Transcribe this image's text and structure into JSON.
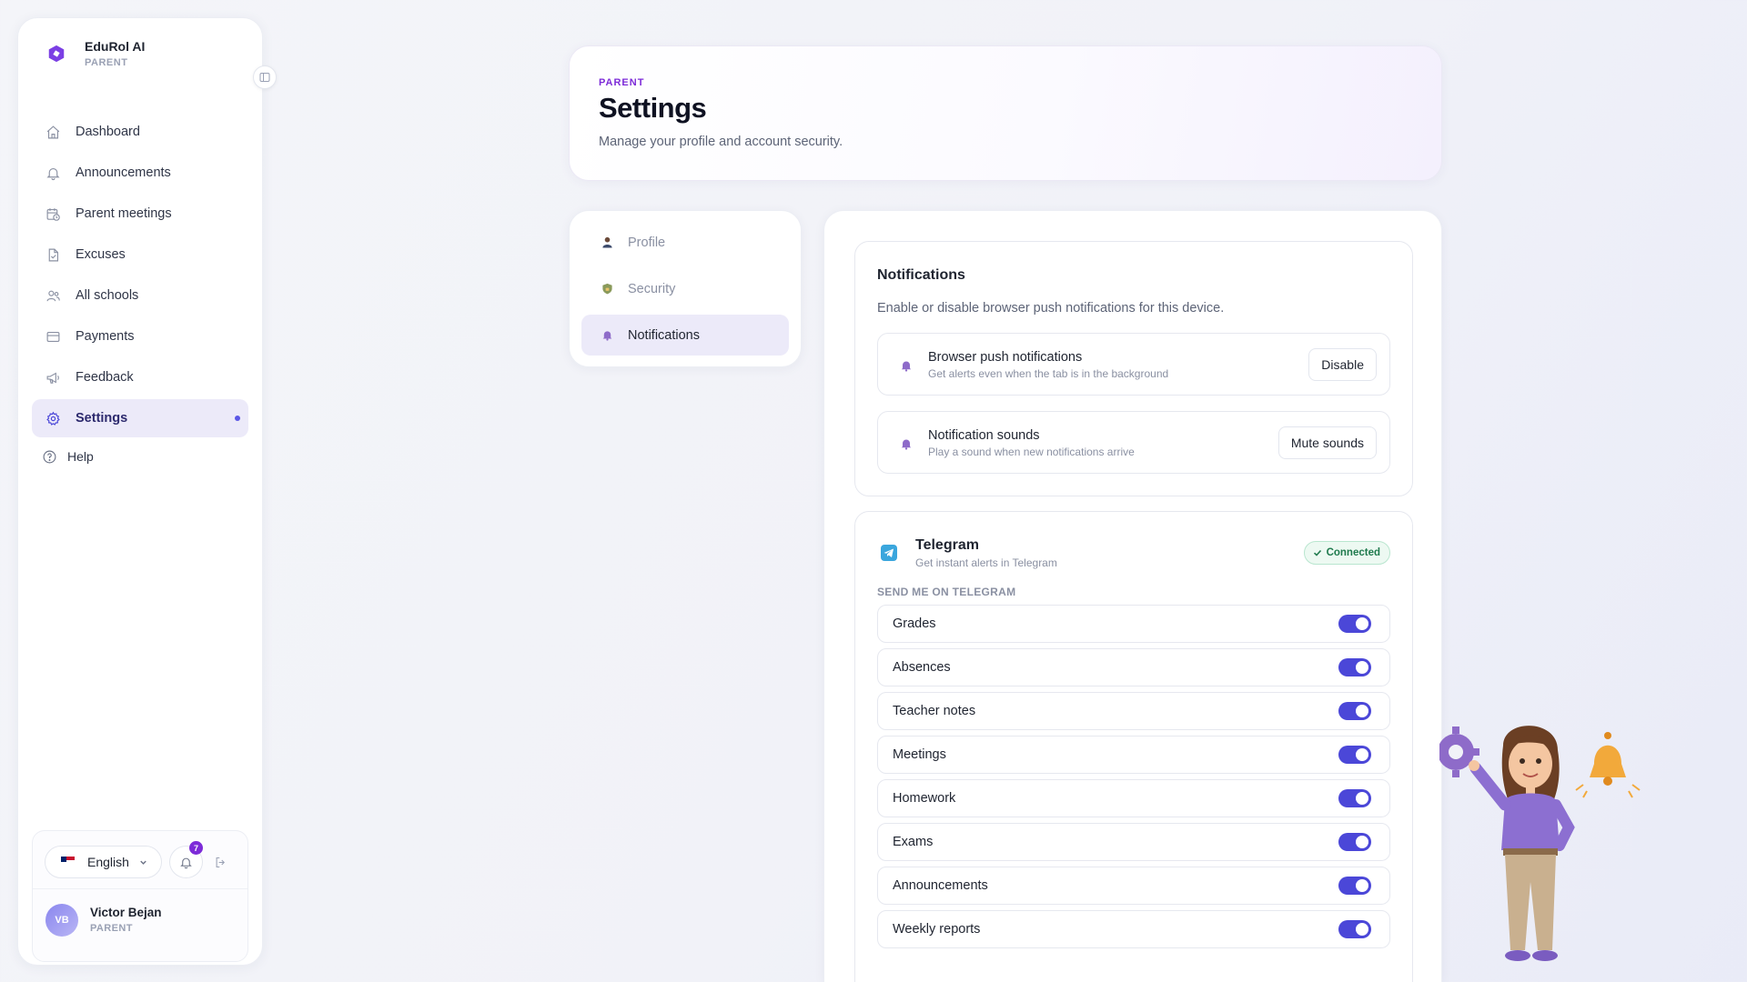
{
  "sidebar": {
    "brand_name": "EduRol AI",
    "brand_role": "PARENT",
    "items": [
      {
        "label": "Dashboard",
        "icon": "home-icon"
      },
      {
        "label": "Announcements",
        "icon": "bell-icon"
      },
      {
        "label": "Parent meetings",
        "icon": "calendar-clock-icon"
      },
      {
        "label": "Excuses",
        "icon": "document-check-icon"
      },
      {
        "label": "All schools",
        "icon": "users-icon"
      },
      {
        "label": "Payments",
        "icon": "credit-card-icon"
      },
      {
        "label": "Feedback",
        "icon": "megaphone-icon"
      },
      {
        "label": "Settings",
        "icon": "gear-icon",
        "active": true
      }
    ],
    "help_label": "Help",
    "language": "English",
    "notification_count": "7",
    "user": {
      "initials": "VB",
      "name": "Victor Bejan",
      "role": "PARENT"
    }
  },
  "header": {
    "eyebrow": "PARENT",
    "title": "Settings",
    "subtitle": "Manage your profile and account security."
  },
  "settings_tabs": [
    {
      "label": "Profile",
      "icon": "person-icon"
    },
    {
      "label": "Security",
      "icon": "shield-icon"
    },
    {
      "label": "Notifications",
      "icon": "bell-icon",
      "active": true
    }
  ],
  "notifications": {
    "title": "Notifications",
    "description": "Enable or disable browser push notifications for this device.",
    "options": [
      {
        "title": "Browser push notifications",
        "subtitle": "Get alerts even when the tab is in the background",
        "button": "Disable"
      },
      {
        "title": "Notification sounds",
        "subtitle": "Play a sound when new notifications arrive",
        "button": "Mute sounds"
      }
    ]
  },
  "telegram": {
    "title": "Telegram",
    "subtitle": "Get instant alerts in Telegram",
    "status": "Connected",
    "section_label": "SEND ME ON TELEGRAM",
    "toggles": [
      {
        "label": "Grades",
        "on": true
      },
      {
        "label": "Absences",
        "on": true
      },
      {
        "label": "Teacher notes",
        "on": true
      },
      {
        "label": "Meetings",
        "on": true
      },
      {
        "label": "Homework",
        "on": true
      },
      {
        "label": "Exams",
        "on": true
      },
      {
        "label": "Announcements",
        "on": true
      },
      {
        "label": "Weekly reports",
        "on": true
      }
    ]
  },
  "colors": {
    "accent": "#4b47d8",
    "brand_purple": "#7d2bd8",
    "connected_green": "#1f7a4d",
    "active_bg": "#eceaf9"
  }
}
